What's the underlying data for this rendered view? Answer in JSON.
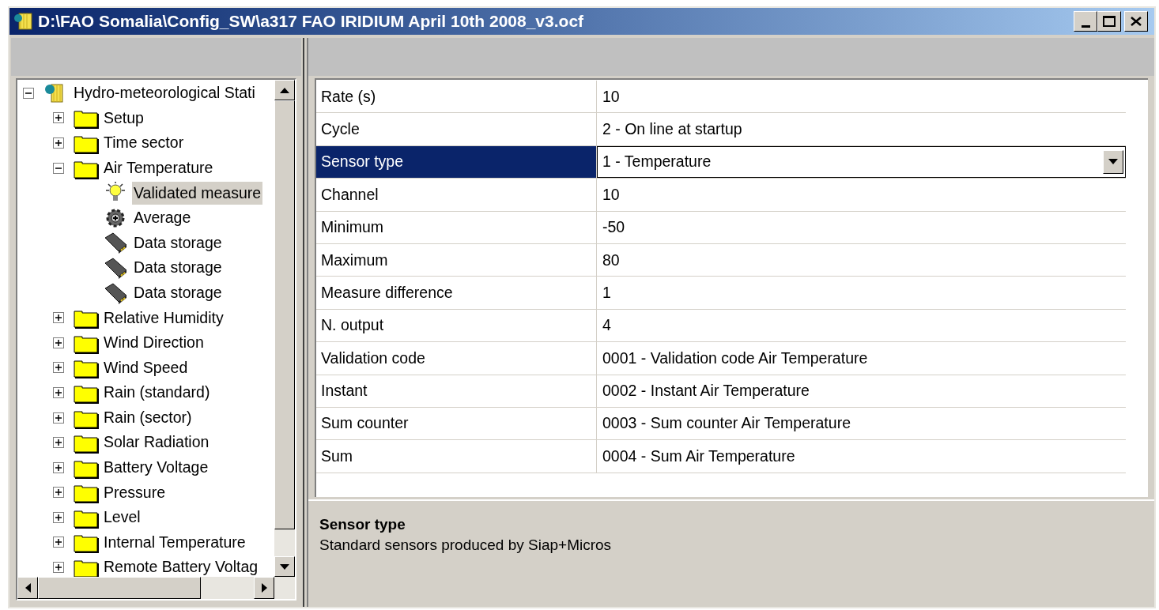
{
  "window": {
    "title": "D:\\FAO Somalia\\Config_SW\\a317 FAO IRIDIUM April 10th 2008_v3.ocf"
  },
  "tree": [
    {
      "label": "Hydro-meteorological Stati",
      "kind": "station",
      "expanded": true,
      "selected": false,
      "children": [
        {
          "label": "Setup",
          "kind": "folder",
          "expanded": false,
          "selected": false
        },
        {
          "label": "Time sector",
          "kind": "folder",
          "expanded": false,
          "selected": false
        },
        {
          "label": "Air Temperature",
          "kind": "folder",
          "expanded": true,
          "selected": false,
          "children": [
            {
              "label": "Validated measure",
              "kind": "bulb",
              "selected": true
            },
            {
              "label": "Average",
              "kind": "gear",
              "selected": false
            },
            {
              "label": "Data storage",
              "kind": "chip",
              "selected": false
            },
            {
              "label": "Data storage",
              "kind": "chip",
              "selected": false
            },
            {
              "label": "Data storage",
              "kind": "chip",
              "selected": false
            }
          ]
        },
        {
          "label": "Relative Humidity",
          "kind": "folder",
          "expanded": false,
          "selected": false
        },
        {
          "label": "Wind Direction",
          "kind": "folder",
          "expanded": false,
          "selected": false
        },
        {
          "label": "Wind Speed",
          "kind": "folder",
          "expanded": false,
          "selected": false
        },
        {
          "label": "Rain (standard)",
          "kind": "folder",
          "expanded": false,
          "selected": false
        },
        {
          "label": "Rain (sector)",
          "kind": "folder",
          "expanded": false,
          "selected": false
        },
        {
          "label": "Solar Radiation",
          "kind": "folder",
          "expanded": false,
          "selected": false
        },
        {
          "label": "Battery Voltage",
          "kind": "folder",
          "expanded": false,
          "selected": false
        },
        {
          "label": "Pressure",
          "kind": "folder",
          "expanded": false,
          "selected": false
        },
        {
          "label": "Level",
          "kind": "folder",
          "expanded": false,
          "selected": false
        },
        {
          "label": "Internal Temperature",
          "kind": "folder",
          "expanded": false,
          "selected": false
        },
        {
          "label": "Remote Battery Voltag",
          "kind": "folder",
          "expanded": false,
          "selected": false
        }
      ]
    }
  ],
  "properties": [
    {
      "label": "Rate (s)",
      "value": "10",
      "kind": "text",
      "selected": false
    },
    {
      "label": "Cycle",
      "value": "2 - On line at startup",
      "kind": "text",
      "selected": false
    },
    {
      "label": "Sensor type",
      "value": "1 - Temperature",
      "kind": "dropdown",
      "selected": true
    },
    {
      "label": "Channel",
      "value": "10",
      "kind": "text",
      "selected": false
    },
    {
      "label": "Minimum",
      "value": "-50",
      "kind": "text",
      "selected": false
    },
    {
      "label": "Maximum",
      "value": "80",
      "kind": "text",
      "selected": false
    },
    {
      "label": "Measure difference",
      "value": "1",
      "kind": "text",
      "selected": false
    },
    {
      "label": "N. output",
      "value": "4",
      "kind": "text",
      "selected": false
    },
    {
      "label": "Validation code",
      "value": "0001 - Validation code  Air Temperature",
      "kind": "text",
      "selected": false
    },
    {
      "label": "Instant",
      "value": "0002 - Instant  Air Temperature",
      "kind": "text",
      "selected": false
    },
    {
      "label": "Sum counter",
      "value": "0003 - Sum counter  Air Temperature",
      "kind": "text",
      "selected": false
    },
    {
      "label": "Sum",
      "value": "0004 - Sum  Air Temperature",
      "kind": "text",
      "selected": false
    }
  ],
  "description": {
    "title": "Sensor type",
    "text": "Standard sensors produced by Siap+Micros"
  }
}
